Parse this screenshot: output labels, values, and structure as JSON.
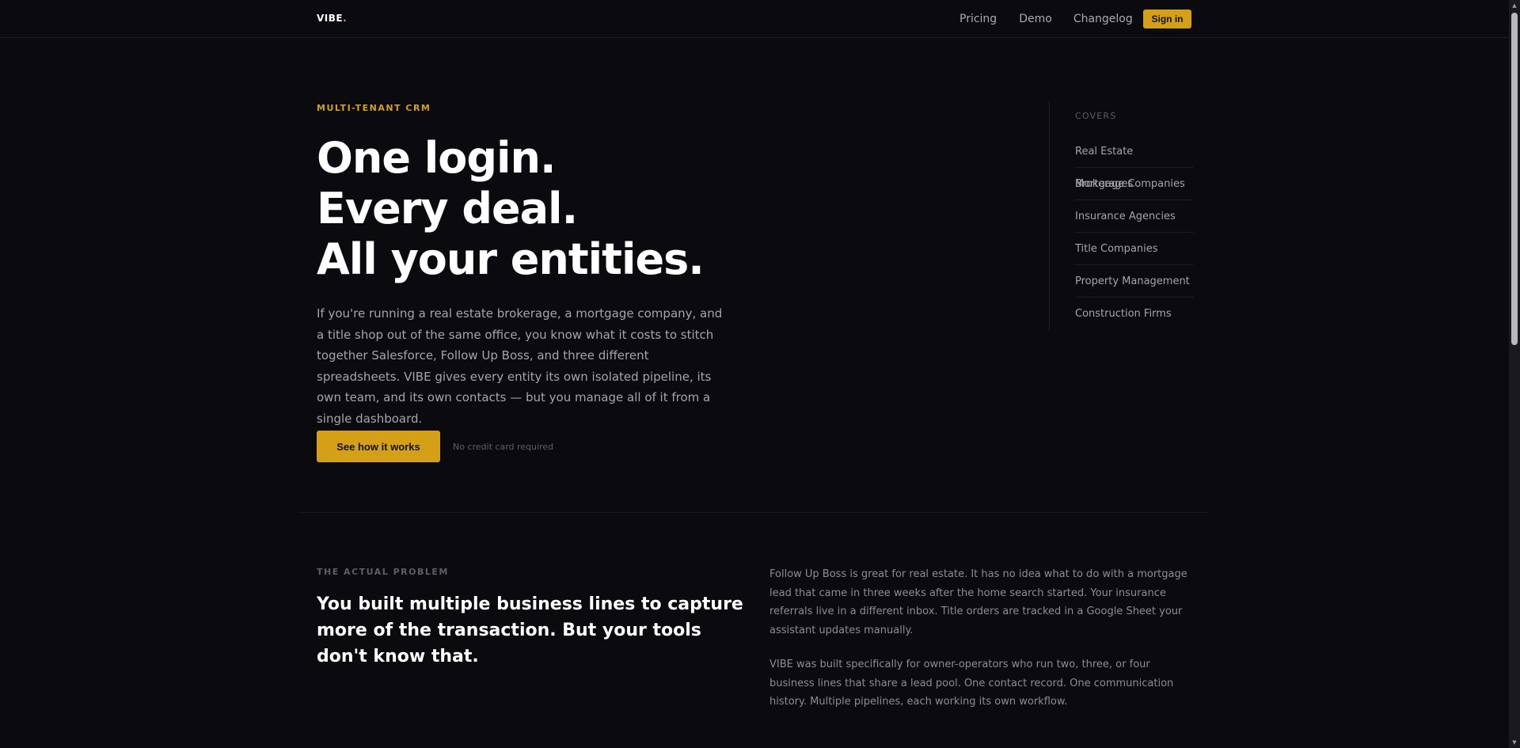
{
  "nav": {
    "brand": "VIBE",
    "brand_dot": ".",
    "links": [
      "Pricing",
      "Demo",
      "Changelog"
    ],
    "signin_label": "Sign in"
  },
  "hero": {
    "eyebrow": "MULTI-TENANT CRM",
    "title_lines": [
      "One login.",
      "Every deal.",
      "All your entities."
    ],
    "body": "If you're running a real estate brokerage, a mortgage company, and a title shop out of the same office, you know what it costs to stitch together Salesforce, Follow Up Boss, and three different spreadsheets. VIBE gives every entity its own isolated pipeline, its own team, and its own contacts — but you manage all of it from a single dashboard.",
    "cta_label": "See how it works",
    "cta_note": "No credit card required"
  },
  "covers": {
    "label": "COVERS",
    "items": [
      "Real Estate Brokerages",
      "Mortgage Companies",
      "Insurance Agencies",
      "Title Companies",
      "Property Management",
      "Construction Firms"
    ]
  },
  "problem": {
    "eyebrow": "THE ACTUAL PROBLEM",
    "title": "You built multiple business lines to capture more of the transaction. But your tools don't know that.",
    "paragraphs": [
      "Follow Up Boss is great for real estate. It has no idea what to do with a mortgage lead that came in three weeks after the home search started. Your insurance referrals live in a different inbox. Title orders are tracked in a Google Sheet your assistant updates manually.",
      "VIBE was built specifically for owner-operators who run two, three, or four business lines that share a lead pool. One contact record. One communication history. Multiple pipelines, each working its own workflow."
    ]
  },
  "colors": {
    "background": "#0b0b0f",
    "accent": "#d4a017",
    "text_primary": "#ffffff",
    "text_muted": "#a4a4ac"
  }
}
